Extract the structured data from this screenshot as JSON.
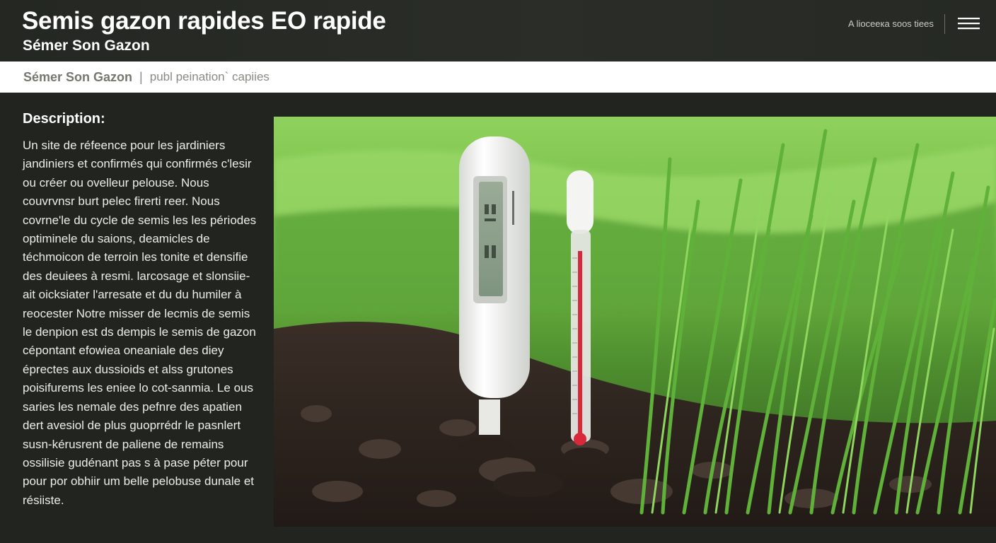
{
  "header": {
    "title": "Semis gazon rapides EO rapide",
    "subtitle": "Sémer Son Gazon",
    "link_label": "A lioceeка soos tiees",
    "menu_icon": "hamburger-menu-icon"
  },
  "breadcrumb": {
    "main": "Sémer Son Gazon",
    "separator": "|",
    "sub": "publ peination` capiies"
  },
  "description": {
    "heading": "Description:",
    "text": "Un site de réfeence pour les jardiniers jandiniers et confirmés qui confirmés c'lesir ou créer ou ovelleur pelouse. Nous couvrvnsr burt pelec firerti reer. Nous covrne'le du cycle de semis les les périodes optiminele du saions, deamicles de téchmoicon de terroin les tonite et densifie des deuiees à resmi. larcosage et slonsiie-ait oicksiater l'arresate et du du humiler à reocester Notre misser de lecmis de semis le denpion est ds dempis le semis de gazon cépontant efowiea oneaniale des diey éprectes aux dussioids et alss grutones poisifurems les eniee lo cot-sanmia. Le ous saries les nemale des pefnre des apatien dert avesiol de plus guoprrédr le pasnlert susn-kérusrent de paliene de remains ossilisie gudénant pas s à pase péter pour pour por obhiir um belle pelobuse dunale et résiiste."
  },
  "photo": {
    "alt_subject": "digital soil meter and thermometer in seedling grass",
    "colors": {
      "grass_light": "#7fc94e",
      "grass_dark": "#3d7a22",
      "soil": "#2e2520",
      "device": "#f1f2ef",
      "thermometer_red": "#d8283a"
    }
  }
}
